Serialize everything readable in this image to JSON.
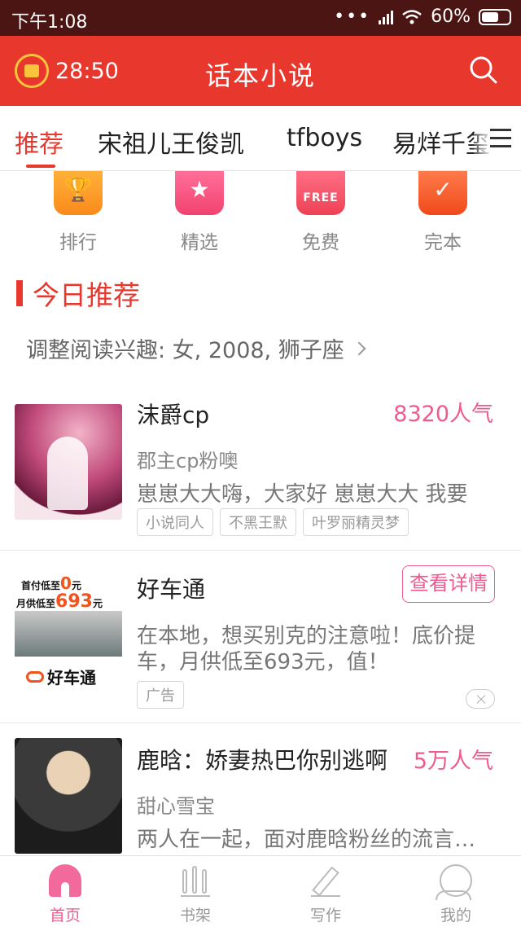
{
  "status_bar": {
    "time": "下午1:08",
    "battery": "60%"
  },
  "header": {
    "timer": "28:50",
    "title": "话本小说"
  },
  "tabs": [
    "推荐",
    "宋祖儿王俊凯",
    "tfboys",
    "易烊千玺"
  ],
  "quick_links": [
    {
      "label": "排行",
      "icon": "trophy-icon"
    },
    {
      "label": "精选",
      "icon": "star-icon"
    },
    {
      "label": "免费",
      "icon": "free-icon",
      "badge": "FREE"
    },
    {
      "label": "完本",
      "icon": "check-icon"
    }
  ],
  "section": {
    "title": "今日推荐",
    "interest": "调整阅读兴趣: 女, 2008, 狮子座"
  },
  "feed": [
    {
      "name": "沫爵cp",
      "popularity": "8320人气",
      "author": "郡主cp粉噢",
      "desc": "崽崽大大嗨，大家好 崽崽大大 我要",
      "tags": [
        "小说同人",
        "不黑王默",
        "叶罗丽精灵梦"
      ]
    },
    {
      "name": "好车通",
      "button": "查看详情",
      "desc_line1": "在本地，想买别克的注意啦！底价提",
      "desc_line2": "车，月供低至693元，值！",
      "tag": "广告",
      "ad": {
        "line1_prefix": "首付低至",
        "line1_value": "0",
        "line1_unit": "元",
        "line2_prefix": "月供低至",
        "line2_value": "693",
        "line2_unit": "元",
        "brand": "好车通"
      }
    },
    {
      "name": "鹿晗：娇妻热巴你别逃啊",
      "popularity": "5万人气",
      "author": "甜心雪宝",
      "desc": "两人在一起，面对鹿晗粉丝的流言蜚语"
    }
  ],
  "bottom_nav": [
    {
      "label": "首页",
      "icon": "home-icon",
      "active": true
    },
    {
      "label": "书架",
      "icon": "bookshelf-icon"
    },
    {
      "label": "写作",
      "icon": "pen-icon"
    },
    {
      "label": "我的",
      "icon": "profile-icon"
    }
  ],
  "colors": {
    "header": "#e8382e",
    "status_bar": "#4a1512",
    "accent_pink": "#ef5a8f"
  }
}
